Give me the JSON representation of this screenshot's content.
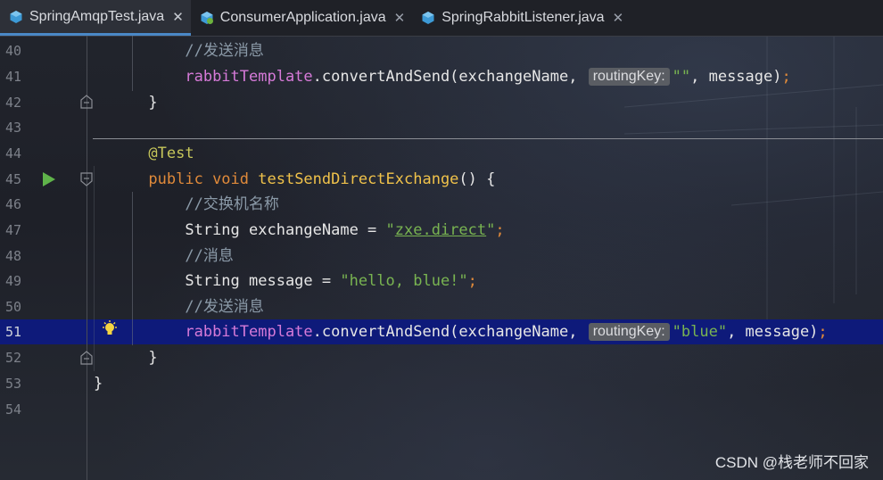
{
  "tabs": [
    {
      "label": "SpringAmqpTest.java",
      "icon": "java-class-icon",
      "active": true
    },
    {
      "label": "ConsumerApplication.java",
      "icon": "spring-boot-class-icon",
      "active": false
    },
    {
      "label": "SpringRabbitListener.java",
      "icon": "java-class-icon",
      "active": false
    }
  ],
  "gutter": {
    "line_numbers": [
      "40",
      "41",
      "42",
      "43",
      "44",
      "45",
      "46",
      "47",
      "48",
      "49",
      "50",
      "51",
      "52",
      "53",
      "54"
    ],
    "current_line": "51"
  },
  "code": {
    "l40": {
      "comment": "//发送消息"
    },
    "l41": {
      "field": "rabbitTemplate",
      "call": ".convertAndSend(exchangeName, ",
      "hint": "routingKey:",
      "arg": "\"\"",
      "rest": ", message)",
      "semi": ";"
    },
    "l42": {
      "text": "}"
    },
    "l44": {
      "annotation": "@Test"
    },
    "l45": {
      "kw": "public void ",
      "method": "testSendDirectExchange",
      "rest": "() {"
    },
    "l46": {
      "comment": "//交换机名称"
    },
    "l47": {
      "decl": "String exchangeName = ",
      "q1": "\"",
      "link": "zxe.direct",
      "q2": "\"",
      "semi": ";"
    },
    "l48": {
      "comment": "//消息"
    },
    "l49": {
      "decl": "String message = ",
      "str": "\"hello, blue!\"",
      "semi": ";"
    },
    "l50": {
      "comment": "//发送消息"
    },
    "l51": {
      "field": "rabbitTemplate",
      "call": ".convertAndSend(exchangeName, ",
      "hint": "routingKey:",
      "arg": "\"blue\"",
      "rest": ", message)",
      "semi": ";"
    },
    "l52": {
      "text": "}"
    },
    "l53": {
      "text": "}"
    }
  },
  "watermark": "CSDN @栈老师不回家",
  "colors": {
    "keyword": "#e08a3a",
    "field": "#d67ad8",
    "string": "#79b451",
    "comment": "#8b9aa8",
    "annotation": "#c6c65a",
    "method": "#f0c24a",
    "current_line": "#0e1a7a"
  }
}
